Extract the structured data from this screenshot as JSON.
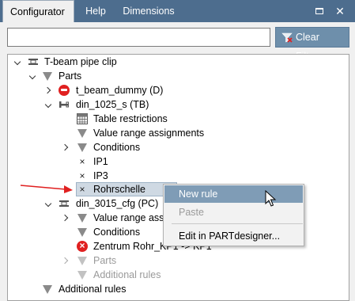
{
  "tabs": {
    "configurator": "Configurator",
    "help": "Help",
    "dimensions": "Dimensions"
  },
  "filter": {
    "value": "",
    "placeholder": "",
    "clear_label": "Clear Filters"
  },
  "tree": {
    "root": "T-beam pipe clip",
    "parts": "Parts",
    "t_beam_dummy": "t_beam_dummy (D)",
    "din_1025_s": "din_1025_s (TB)",
    "table_restrictions": "Table restrictions",
    "value_range_assignments": "Value range assignments",
    "conditions": "Conditions",
    "ip1": "IP1",
    "ip3": "IP3",
    "rohrschelle": "Rohrschelle",
    "din_3015_cfg": "din_3015_cfg (PC)",
    "value_range_assign_trunc": "Value range assig",
    "conditions2": "Conditions",
    "zentrum": "Zentrum Rohr_KP1 -> KP1",
    "parts_sub": "Parts",
    "additional_rules_sub": "Additional rules",
    "additional_rules": "Additional rules"
  },
  "context_menu": {
    "new_rule": "New rule",
    "paste": "Paste",
    "edit_in_partdesigner": "Edit in PARTdesigner..."
  },
  "colors": {
    "tabbar": "#4d6d8e",
    "accent_button": "#6e8fab",
    "menu_highlight": "#7f9cb6",
    "annotation_arrow": "#e02020"
  }
}
